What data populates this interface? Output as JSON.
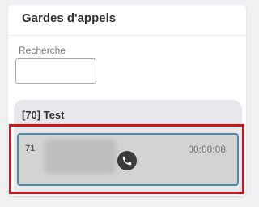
{
  "panel": {
    "title": "Gardes d'appels"
  },
  "search": {
    "label": "Recherche",
    "value": "",
    "placeholder": ""
  },
  "group": {
    "title": "[70] Test"
  },
  "call": {
    "number": "71",
    "duration": "00:00:08",
    "icon": "phone-icon"
  },
  "colors": {
    "highlight": "#d3141b",
    "card_border": "#4e8aa3",
    "card_bg": "#d3d3d3"
  }
}
